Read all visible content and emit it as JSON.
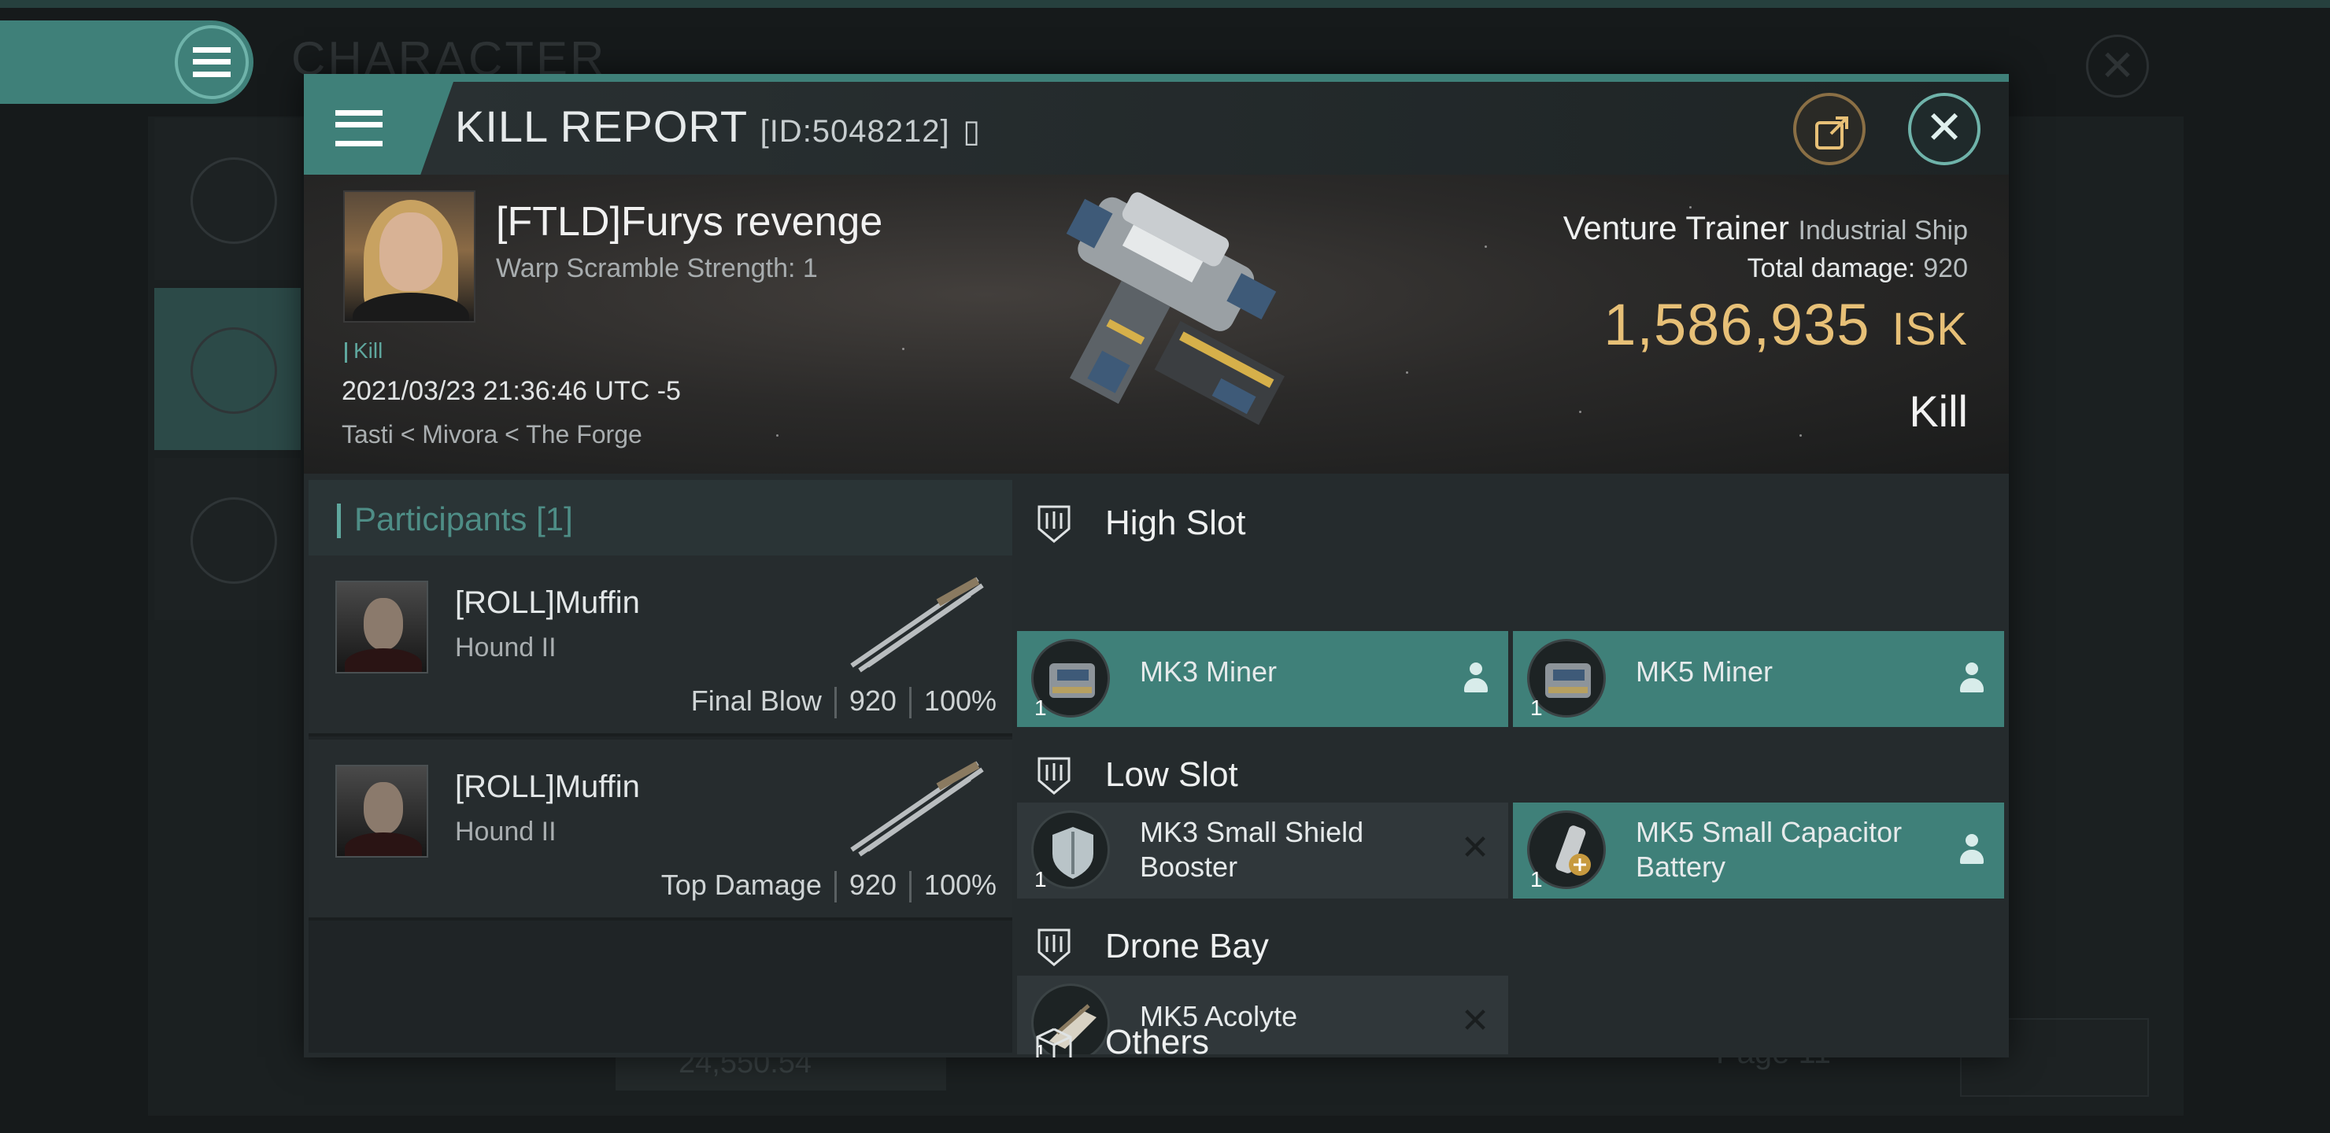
{
  "background": {
    "title": "CHARACTER",
    "bottom_value": "24,550.54",
    "page_label": "Page 11"
  },
  "dialog": {
    "title": "KILL REPORT",
    "id_label": "[ID:5048212]"
  },
  "victim": {
    "name": "[FTLD]Furys revenge",
    "warp_scramble": "Warp Scramble Strength: 1",
    "kill_tag": "Kill",
    "datetime": "2021/03/23 21:36:46 UTC -5",
    "location": "Tasti < Mivora < The Forge",
    "ship_name": "Venture Trainer",
    "ship_class": "Industrial Ship",
    "total_damage_label": "Total damage:",
    "total_damage_value": "920",
    "isk_value": "1,586,935",
    "isk_unit": "ISK",
    "result": "Kill"
  },
  "participants": {
    "header": "Participants [1]",
    "rows": [
      {
        "name": "[ROLL]Muffin",
        "ship": "Hound II",
        "role": "Final Blow",
        "damage": "920",
        "percent": "100%"
      },
      {
        "name": "[ROLL]Muffin",
        "ship": "Hound II",
        "role": "Top Damage",
        "damage": "920",
        "percent": "100%"
      }
    ]
  },
  "slots": {
    "high": {
      "label": "High Slot",
      "items": [
        {
          "name": "MK3 Miner",
          "qty": "1",
          "state": "person-icon"
        },
        {
          "name": "MK5 Miner",
          "qty": "1",
          "state": "person-icon"
        }
      ]
    },
    "low": {
      "label": "Low Slot",
      "items": [
        {
          "name": "MK3 Small Shield Booster",
          "qty": "1",
          "state": "destroyed-x-icon"
        },
        {
          "name": "MK5 Small Capacitor Battery",
          "qty": "1",
          "state": "person-icon"
        }
      ]
    },
    "drone": {
      "label": "Drone Bay",
      "items": [
        {
          "name": "MK5  Acolyte",
          "qty": "1",
          "state": "destroyed-x-icon"
        }
      ]
    },
    "others": {
      "label": "Others"
    }
  },
  "colors": {
    "accent": "#3f8079",
    "isk": "#e7c077",
    "background": "#161a1b"
  }
}
